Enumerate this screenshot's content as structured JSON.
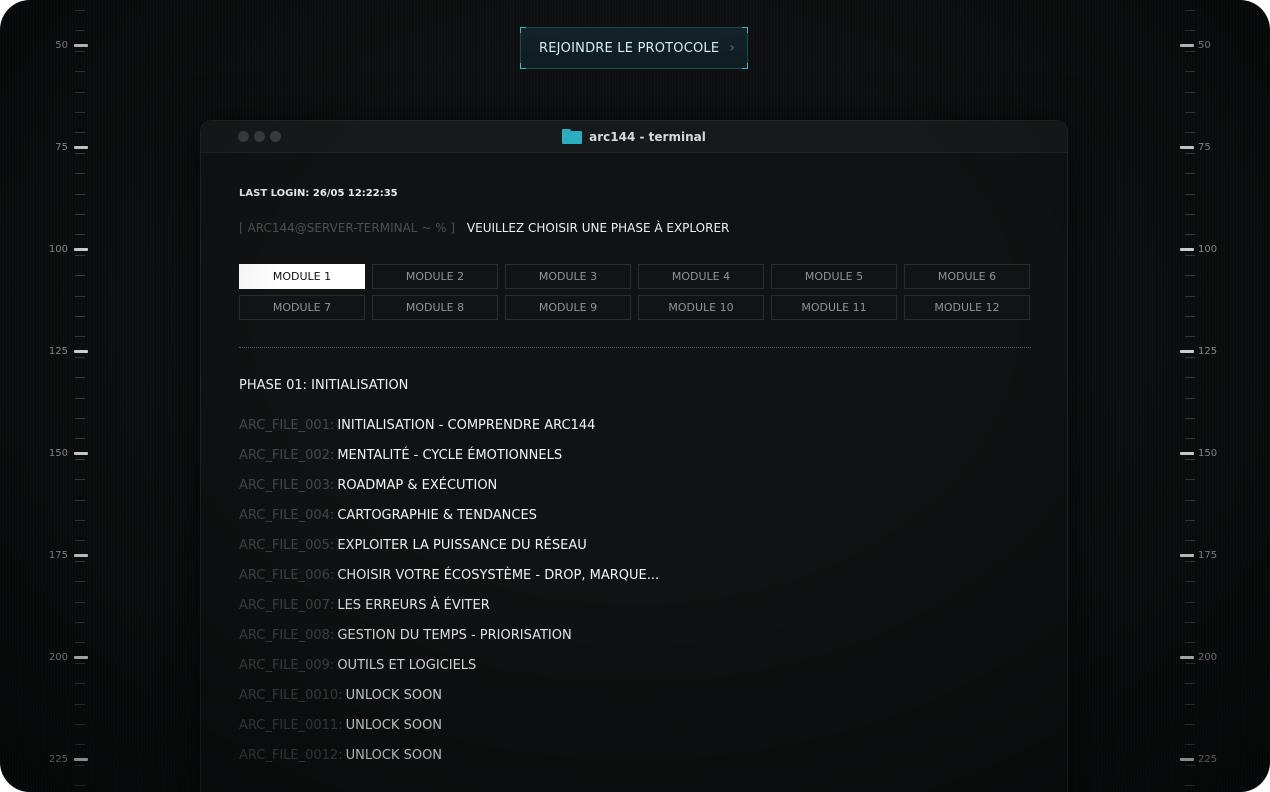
{
  "cta": {
    "label": "REJOINDRE LE PROTOCOLE",
    "icon": "chevron-right-icon"
  },
  "rulers": {
    "labels": [
      "50",
      "75",
      "100",
      "125",
      "150",
      "175",
      "200",
      "225"
    ]
  },
  "window": {
    "title": "arc144 - terminal",
    "folder_icon_color": "#2aaebf",
    "last_login": "LAST LOGIN: 26/05 12:22:35",
    "prompt_prefix": "[ ARC144@SERVER-TERMINAL ~ %  ]",
    "prompt_message": "VEUILLEZ CHOISIR UNE PHASE À EXPLORER",
    "modules": [
      "MODULE 1",
      "MODULE 2",
      "MODULE 3",
      "MODULE 4",
      "MODULE 5",
      "MODULE 6",
      "MODULE 7",
      "MODULE 8",
      "MODULE 9",
      "MODULE 10",
      "MODULE 11",
      "MODULE 12"
    ],
    "active_module_index": 0,
    "phase_title": "PHASE 01: INITIALISATION",
    "files": [
      {
        "id": "ARC_FILE_001:",
        "name": "INITIALISATION - COMPRENDRE ARC144"
      },
      {
        "id": "ARC_FILE_002:",
        "name": "MENTALITÉ - CYCLE ÉMOTIONNELS"
      },
      {
        "id": "ARC_FILE_003:",
        "name": "ROADMAP & EXÉCUTION"
      },
      {
        "id": "ARC_FILE_004:",
        "name": "CARTOGRAPHIE & TENDANCES"
      },
      {
        "id": "ARC_FILE_005:",
        "name": "EXPLOITER LA PUISSANCE DU RÉSEAU"
      },
      {
        "id": "ARC_FILE_006:",
        "name": "CHOISIR VOTRE ÉCOSYSTÈME - DROP, MARQUE..."
      },
      {
        "id": "ARC_FILE_007:",
        "name": "LES ERREURS À ÉVITER"
      },
      {
        "id": "ARC_FILE_008:",
        "name": "GESTION DU TEMPS - PRIORISATION"
      },
      {
        "id": "ARC_FILE_009:",
        "name": "OUTILS ET LOGICIELS"
      },
      {
        "id": "ARC_FILE_0010:",
        "name": "UNLOCK SOON"
      },
      {
        "id": "ARC_FILE_0011:",
        "name": "UNLOCK SOON"
      },
      {
        "id": "ARC_FILE_0012:",
        "name": "UNLOCK SOON"
      }
    ]
  },
  "colors": {
    "background": "#0d0f10",
    "accent": "#2aaebf",
    "text_primary": "#f3f5f5",
    "text_muted": "#454a4d"
  }
}
